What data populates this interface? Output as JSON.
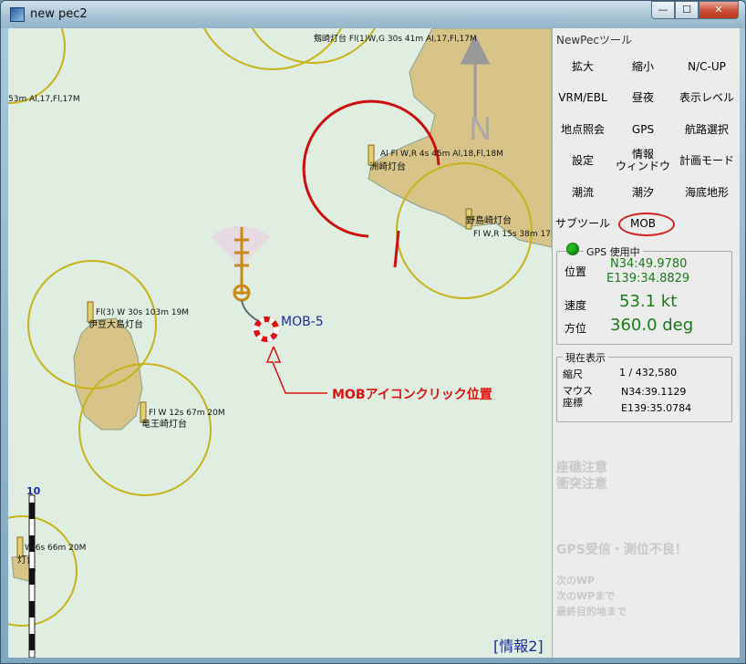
{
  "window": {
    "title": "new pec2",
    "min_glyph": "—",
    "max_glyph": "☐",
    "close_glyph": "✕"
  },
  "map": {
    "labels": {
      "lh1": "剱崎灯台 Fl(1)W,G 30s 41m AI,17,Fl,17M",
      "lh2": "53m Al,17,Fl,17M",
      "lh3": "Al Fl W,R 4s 45m Al,18,Fl,18M",
      "lh3b": "洲崎灯台",
      "lh4": "野島崎灯台",
      "lh4b": "Fl W,R 15s 38m 17M",
      "lh5": "Fl(3) W 30s 103m 19M",
      "lh5b": "伊豆大島灯台",
      "lh6": "Fl W 12s 67m 20M",
      "lh6b": "竜王崎灯台",
      "lh7": "W 6s 66m 20M",
      "lh7b": "灯台",
      "scale": "10",
      "north": "N"
    },
    "mob_label": "MOB-5",
    "annotation": "MOBアイコンクリック位置",
    "footer": "[情報2]"
  },
  "panel": {
    "title": "NewPecツール",
    "buttons": [
      {
        "label": "拡大"
      },
      {
        "label": "縮小"
      },
      {
        "label": "N/C-UP"
      },
      {
        "label": "VRM/EBL"
      },
      {
        "label": "昼夜"
      },
      {
        "label": "表示レベル"
      },
      {
        "label": "地点照会"
      },
      {
        "label": "GPS"
      },
      {
        "label": "航路選択"
      },
      {
        "label": "設定"
      },
      {
        "label": "情報\nウィンドウ"
      },
      {
        "label": "計画モード"
      },
      {
        "label": "潮流"
      },
      {
        "label": "潮汐"
      },
      {
        "label": "海底地形"
      },
      {
        "label": "サブツール"
      },
      {
        "label": "MOB"
      }
    ],
    "gps": {
      "title": "GPS 使用中",
      "position_label": "位置",
      "lat": "N34:49.9780",
      "lon": "E139:34.8829",
      "speed_label": "速度",
      "speed": "53.1 kt",
      "heading_label": "方位",
      "heading": "360.0 deg",
      "status_color": "#22bb22"
    },
    "current": {
      "title": "現在表示",
      "scale_label": "縮尺",
      "scale": "1 / 432,580",
      "mouse_label": "マウス\n座標",
      "mouse_lat": "N34:39.1129",
      "mouse_lon": "E139:35.0784"
    },
    "warnings": [
      "座礁注意",
      "衝突注意",
      "GPS受信・測位不良！"
    ],
    "wp": [
      "次のWP",
      "次のWPまで",
      "最終目的地まで"
    ]
  },
  "colors": {
    "sea": "#dfeee1",
    "land": "#d9c58a",
    "arc": "#c8b21a",
    "vrm": "#cc1010",
    "ship": "#c88a14",
    "annot": "#e01010"
  }
}
